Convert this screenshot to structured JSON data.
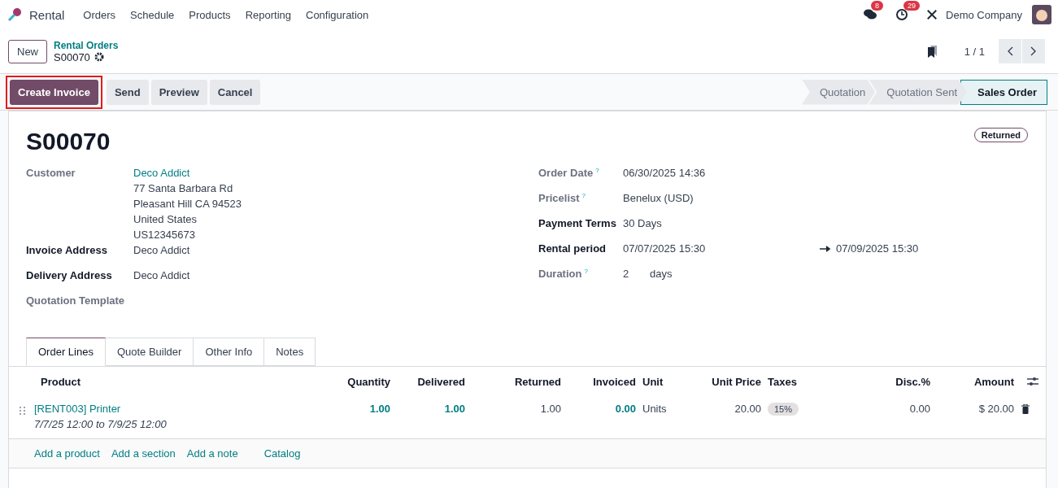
{
  "navbar": {
    "app": "Rental",
    "menu": [
      "Orders",
      "Schedule",
      "Products",
      "Reporting",
      "Configuration"
    ],
    "messages_badge": "8",
    "activities_badge": "29",
    "company": "Demo Company"
  },
  "control_panel": {
    "new_button": "New",
    "breadcrumb": "Rental Orders",
    "record": "S00070",
    "pager": "1 / 1"
  },
  "actions": [
    {
      "label": "Create Invoice",
      "primary": true,
      "highlighted": true
    },
    {
      "label": "Send",
      "primary": false
    },
    {
      "label": "Preview",
      "primary": false
    },
    {
      "label": "Cancel",
      "primary": false
    }
  ],
  "stages": [
    {
      "label": "Quotation",
      "selected": false
    },
    {
      "label": "Quotation Sent",
      "selected": false
    },
    {
      "label": "Sales Order",
      "selected": true
    }
  ],
  "form": {
    "title": "S00070",
    "ribbon": "Returned",
    "left_fields": [
      {
        "label": "Customer",
        "strong": false,
        "value": "Deco Addict",
        "link": true,
        "lines": [
          "77 Santa Barbara Rd",
          "Pleasant Hill CA 94523",
          "United States",
          "US12345673"
        ]
      },
      {
        "label": "Invoice Address",
        "strong": true,
        "value": "Deco Addict",
        "link": false
      },
      {
        "label": "Delivery Address",
        "strong": true,
        "value": "Deco Addict",
        "link": false
      },
      {
        "label": "Quotation Template",
        "strong": false
      }
    ],
    "right_fields": [
      {
        "label": "Order Date",
        "strong": false,
        "help": "?",
        "value": "06/30/2025 14:36"
      },
      {
        "label": "Pricelist",
        "strong": false,
        "help": "?",
        "value": "Benelux (USD)"
      },
      {
        "label": "Payment Terms",
        "strong": true,
        "value": "30 Days"
      },
      {
        "label": "Rental period",
        "strong": true,
        "value": "07/07/2025 15:30",
        "end": "07/09/2025 15:30"
      },
      {
        "label": "Duration",
        "strong": false,
        "help": "?",
        "value": "2",
        "unit": "days"
      }
    ]
  },
  "tabs": [
    {
      "label": "Order Lines",
      "selected": true
    },
    {
      "label": "Quote Builder",
      "selected": false
    },
    {
      "label": "Other Info",
      "selected": false
    },
    {
      "label": "Notes",
      "selected": false
    }
  ],
  "table": {
    "columns": [
      "Product",
      "Quantity",
      "Delivered",
      "Returned",
      "Invoiced",
      "Unit",
      "Unit Price",
      "Taxes",
      "Disc.%",
      "Amount"
    ],
    "rows": [
      {
        "cells": [
          {
            "kind": "product",
            "text": "[RENT003] Printer",
            "sub": "7/7/25 12:00 to 7/9/25 12:00"
          },
          {
            "kind": "linked",
            "text": "1.00"
          },
          {
            "kind": "linked",
            "text": "1.00"
          },
          {
            "kind": "plain",
            "text": "1.00"
          },
          {
            "kind": "linked",
            "text": "0.00"
          },
          {
            "kind": "plain",
            "text": "Units"
          },
          {
            "kind": "plain",
            "text": "20.00"
          },
          {
            "kind": "tag",
            "text": "15%"
          },
          {
            "kind": "plain",
            "text": "0.00"
          },
          {
            "kind": "plain",
            "text": "$ 20.00"
          }
        ]
      }
    ],
    "add_links": [
      "Add a product",
      "Add a section",
      "Add a note"
    ],
    "catalog": "Catalog"
  }
}
